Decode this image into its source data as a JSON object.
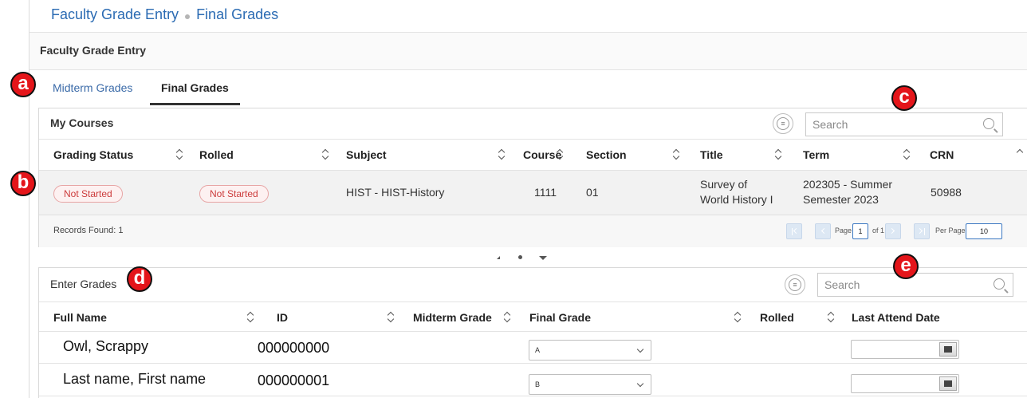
{
  "breadcrumb": {
    "root": "Faculty Grade Entry",
    "current": "Final Grades"
  },
  "section_header": "Faculty Grade Entry",
  "tabs": [
    {
      "label": "Midterm Grades",
      "active": false
    },
    {
      "label": "Final Grades",
      "active": true
    }
  ],
  "courses": {
    "title": "My Courses",
    "search_placeholder": "Search",
    "columns": [
      "Grading Status",
      "Rolled",
      "Subject",
      "Course",
      "Section",
      "Title",
      "Term",
      "CRN"
    ],
    "row": {
      "grading_status": "Not Started",
      "rolled": "Not Started",
      "subject": "HIST - HIST-History",
      "course": "1111",
      "section": "01",
      "title_line1": "Survey of",
      "title_line2": "World History I",
      "term_line1": "202305 - Summer",
      "term_line2": "Semester 2023",
      "crn": "50988"
    },
    "footer": {
      "records": "Records Found: 1",
      "page_label": "Page",
      "page_value": "1",
      "of_label": "of 1",
      "per_page_label": "Per Page",
      "per_page_value": "10"
    }
  },
  "grades": {
    "title": "Enter Grades",
    "search_placeholder": "Search",
    "columns": [
      "Full Name",
      "ID",
      "Midterm Grade",
      "Final Grade",
      "Rolled",
      "Last Attend Date"
    ],
    "rows": [
      {
        "name": "Owl, Scrappy",
        "id": "000000000",
        "final_grade": "A"
      },
      {
        "name": "Last name, First name",
        "id": "000000001",
        "final_grade": "B"
      }
    ]
  },
  "markers": {
    "a": "a",
    "b": "b",
    "c": "c",
    "d": "d",
    "e": "e"
  },
  "colors": {
    "link": "#2b6bb3",
    "badge_text": "#cc3b3b",
    "marker": "#e4151a"
  }
}
